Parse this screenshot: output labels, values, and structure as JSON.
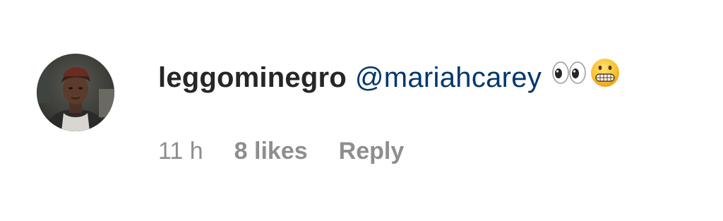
{
  "comment": {
    "avatar_icon": "profile-photo",
    "username": "leggominegro",
    "mention": "@mariahcarey",
    "emojis": [
      "eyes-emoji",
      "grimacing-face-emoji"
    ],
    "time": "11 h",
    "likes": "8 likes",
    "reply_label": "Reply"
  },
  "colors": {
    "text_primary": "#262626",
    "mention": "#00376b",
    "meta": "#8e8e8e",
    "background": "#ffffff"
  }
}
